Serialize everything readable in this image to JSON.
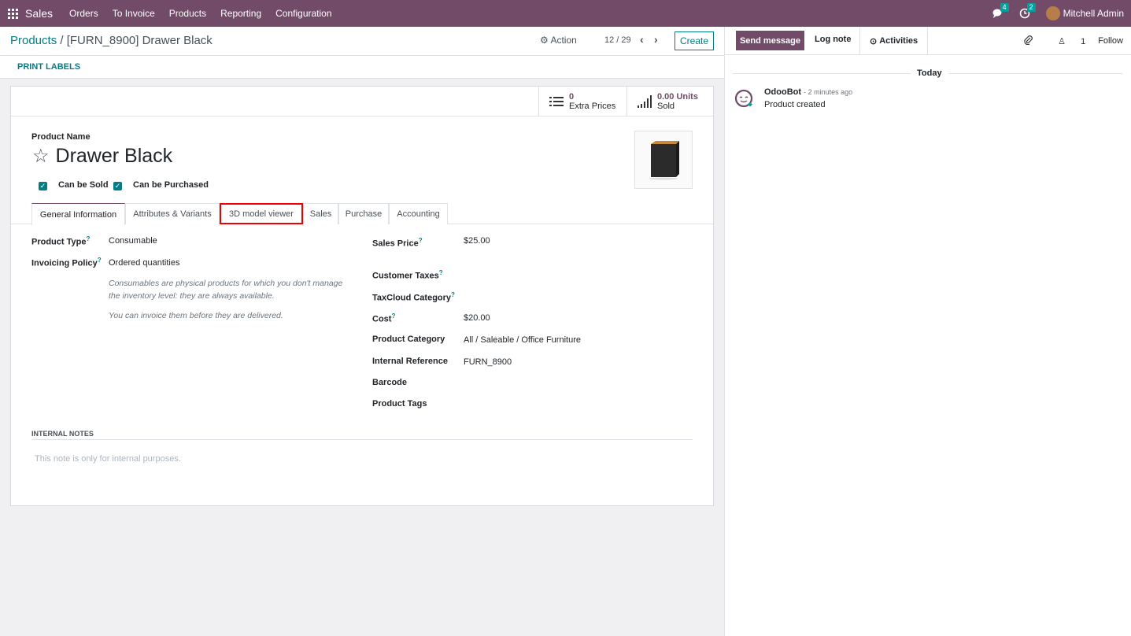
{
  "navbar": {
    "app_name": "Sales",
    "menu": [
      "Orders",
      "To Invoice",
      "Products",
      "Reporting",
      "Configuration"
    ],
    "messages_count": "4",
    "activities_count": "2",
    "user": "Mitchell Admin"
  },
  "control": {
    "breadcrumb_parent": "Products",
    "breadcrumb_sep": "/",
    "breadcrumb_current": "[FURN_8900] Drawer Black",
    "action_label": "Action",
    "pager": "12 / 29",
    "create_label": "Create",
    "print_labels": "PRINT LABELS"
  },
  "smart_buttons": [
    {
      "value": "0",
      "label": "Extra Prices"
    },
    {
      "value": "0.00 Units",
      "label": "Sold"
    }
  ],
  "product": {
    "name_label": "Product Name",
    "name": "Drawer Black",
    "can_be_sold_label": "Can be Sold",
    "can_be_purchased_label": "Can be Purchased"
  },
  "tabs": [
    "General Information",
    "Attributes & Variants",
    "3D model viewer",
    "Sales",
    "Purchase",
    "Accounting"
  ],
  "left_fields": {
    "product_type_label": "Product Type",
    "product_type": "Consumable",
    "invoicing_policy_label": "Invoicing Policy",
    "invoicing_policy": "Ordered quantities",
    "help_1": "Consumables are physical products for which you don't manage the inventory level: they are always available.",
    "help_2": "You can invoice them before they are delivered."
  },
  "right_fields": {
    "sales_price_label": "Sales Price",
    "sales_price": "$25.00",
    "customer_taxes_label": "Customer Taxes",
    "taxcloud_label": "TaxCloud Category",
    "cost_label": "Cost",
    "cost": "$20.00",
    "category_label": "Product Category",
    "category": "All / Saleable / Office Furniture",
    "internal_ref_label": "Internal Reference",
    "internal_ref": "FURN_8900",
    "barcode_label": "Barcode",
    "tags_label": "Product Tags"
  },
  "notes": {
    "heading": "INTERNAL NOTES",
    "placeholder": "This note is only for internal purposes."
  },
  "chatter": {
    "send_message": "Send message",
    "log_note": "Log note",
    "activities": "Activities",
    "followers_count": "1",
    "follow": "Follow",
    "today": "Today",
    "author": "OdooBot",
    "time": "- 2 minutes ago",
    "message": "Product created"
  },
  "colors": {
    "brand": "#714b67",
    "accent": "#017e84"
  }
}
